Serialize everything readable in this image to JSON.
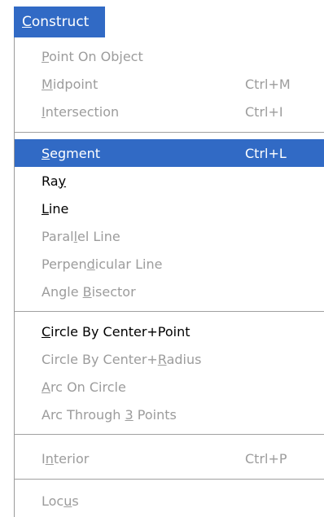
{
  "menubar": {
    "menu": {
      "pre": "",
      "mn": "C",
      "post": "onstruct"
    }
  },
  "items": [
    {
      "pre": "",
      "mn": "P",
      "post": "oint On Object",
      "shortcut": ""
    },
    {
      "pre": "",
      "mn": "M",
      "post": "idpoint",
      "shortcut": "Ctrl+M"
    },
    {
      "pre": "",
      "mn": "I",
      "post": "ntersection",
      "shortcut": "Ctrl+I"
    },
    {
      "pre": "",
      "mn": "S",
      "post": "egment",
      "shortcut": "Ctrl+L"
    },
    {
      "pre": "Ra",
      "mn": "y",
      "post": "",
      "shortcut": ""
    },
    {
      "pre": "",
      "mn": "L",
      "post": "ine",
      "shortcut": ""
    },
    {
      "pre": "Paral",
      "mn": "l",
      "post": "el Line",
      "shortcut": ""
    },
    {
      "pre": "Perpen",
      "mn": "d",
      "post": "icular Line",
      "shortcut": ""
    },
    {
      "pre": "Angle ",
      "mn": "B",
      "post": "isector",
      "shortcut": ""
    },
    {
      "pre": "",
      "mn": "C",
      "post": "ircle By Center+Point",
      "shortcut": ""
    },
    {
      "pre": "Circle By Center+",
      "mn": "R",
      "post": "adius",
      "shortcut": ""
    },
    {
      "pre": "",
      "mn": "A",
      "post": "rc On Circle",
      "shortcut": ""
    },
    {
      "pre": "Arc Through ",
      "mn": "3",
      "post": " Points",
      "shortcut": ""
    },
    {
      "pre": "I",
      "mn": "n",
      "post": "terior",
      "shortcut": "Ctrl+P"
    },
    {
      "pre": "Loc",
      "mn": "u",
      "post": "s",
      "shortcut": ""
    }
  ]
}
